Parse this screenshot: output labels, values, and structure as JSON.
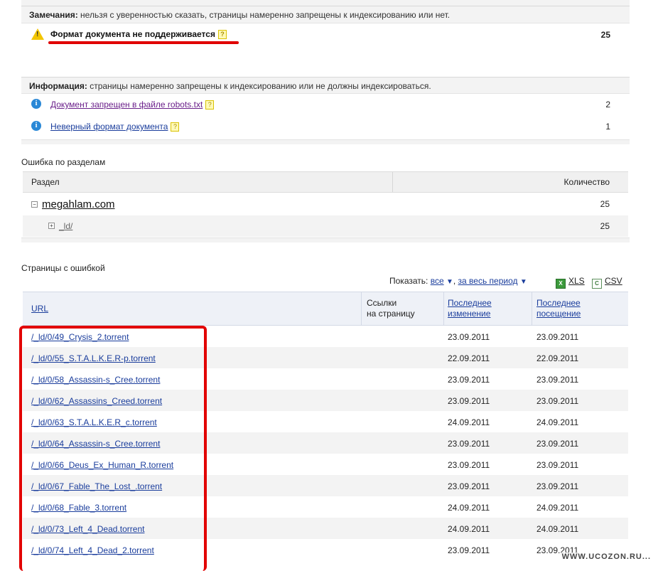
{
  "notes": {
    "label": "Замечания:",
    "text": " нельзя с уверенностью сказать, страницы намеренно запрещены к индексированию или нет.",
    "items": [
      {
        "label": "Формат документа не поддерживается",
        "help": "?",
        "count": "25"
      }
    ]
  },
  "info": {
    "label": "Информация:",
    "text": " страницы намеренно запрещены к индексированию или не должны индексироваться.",
    "items": [
      {
        "label": "Документ запрещен в файле robots.txt",
        "help": "?",
        "count": "2"
      },
      {
        "label": "Неверный формат документа",
        "help": "?",
        "count": "1"
      }
    ]
  },
  "sections": {
    "title": "Ошибка по разделам",
    "col_section": "Раздел",
    "col_count": "Количество",
    "rows": [
      {
        "toggle": "−",
        "name": "megahlam.com",
        "count": "25"
      },
      {
        "toggle": "+",
        "name": "_ld/",
        "count": "25"
      }
    ]
  },
  "pages": {
    "title": "Страницы с ошибкой",
    "show_label": "Показать:",
    "filter_all": "все",
    "filter_period": "за весь период",
    "export_xls": "XLS",
    "export_csv": "CSV",
    "col_url": "URL",
    "col_links_1": "Ссылки",
    "col_links_2": "на страницу",
    "col_changed_1": "Последнее",
    "col_changed_2": "изменение",
    "col_visited_1": "Последнее",
    "col_visited_2": "посещение",
    "rows": [
      {
        "url": "/_ld/0/49_Crysis_2.torrent",
        "changed": "23.09.2011",
        "visited": "23.09.2011"
      },
      {
        "url": "/_ld/0/55_S.T.A.L.K.E.R-p.torrent",
        "changed": "22.09.2011",
        "visited": "22.09.2011"
      },
      {
        "url": "/_ld/0/58_Assassin-s_Cree.torrent",
        "changed": "23.09.2011",
        "visited": "23.09.2011"
      },
      {
        "url": "/_ld/0/62_Assassins_Creed.torrent",
        "changed": "23.09.2011",
        "visited": "23.09.2011"
      },
      {
        "url": "/_ld/0/63_S.T.A.L.K.E.R_c.torrent",
        "changed": "24.09.2011",
        "visited": "24.09.2011"
      },
      {
        "url": "/_ld/0/64_Assassin-s_Cree.torrent",
        "changed": "23.09.2011",
        "visited": "23.09.2011"
      },
      {
        "url": "/_ld/0/66_Deus_Ex_Human_R.torrent",
        "changed": "23.09.2011",
        "visited": "23.09.2011"
      },
      {
        "url": "/_ld/0/67_Fable_The_Lost_.torrent",
        "changed": "23.09.2011",
        "visited": "23.09.2011"
      },
      {
        "url": "/_ld/0/68_Fable_3.torrent",
        "changed": "24.09.2011",
        "visited": "24.09.2011"
      },
      {
        "url": "/_ld/0/73_Left_4_Dead.torrent",
        "changed": "24.09.2011",
        "visited": "24.09.2011"
      },
      {
        "url": "/_ld/0/74_Left_4_Dead_2.torrent",
        "changed": "23.09.2011",
        "visited": "23.09.2011"
      }
    ]
  },
  "watermark": "WWW.UCOZON.RU..."
}
